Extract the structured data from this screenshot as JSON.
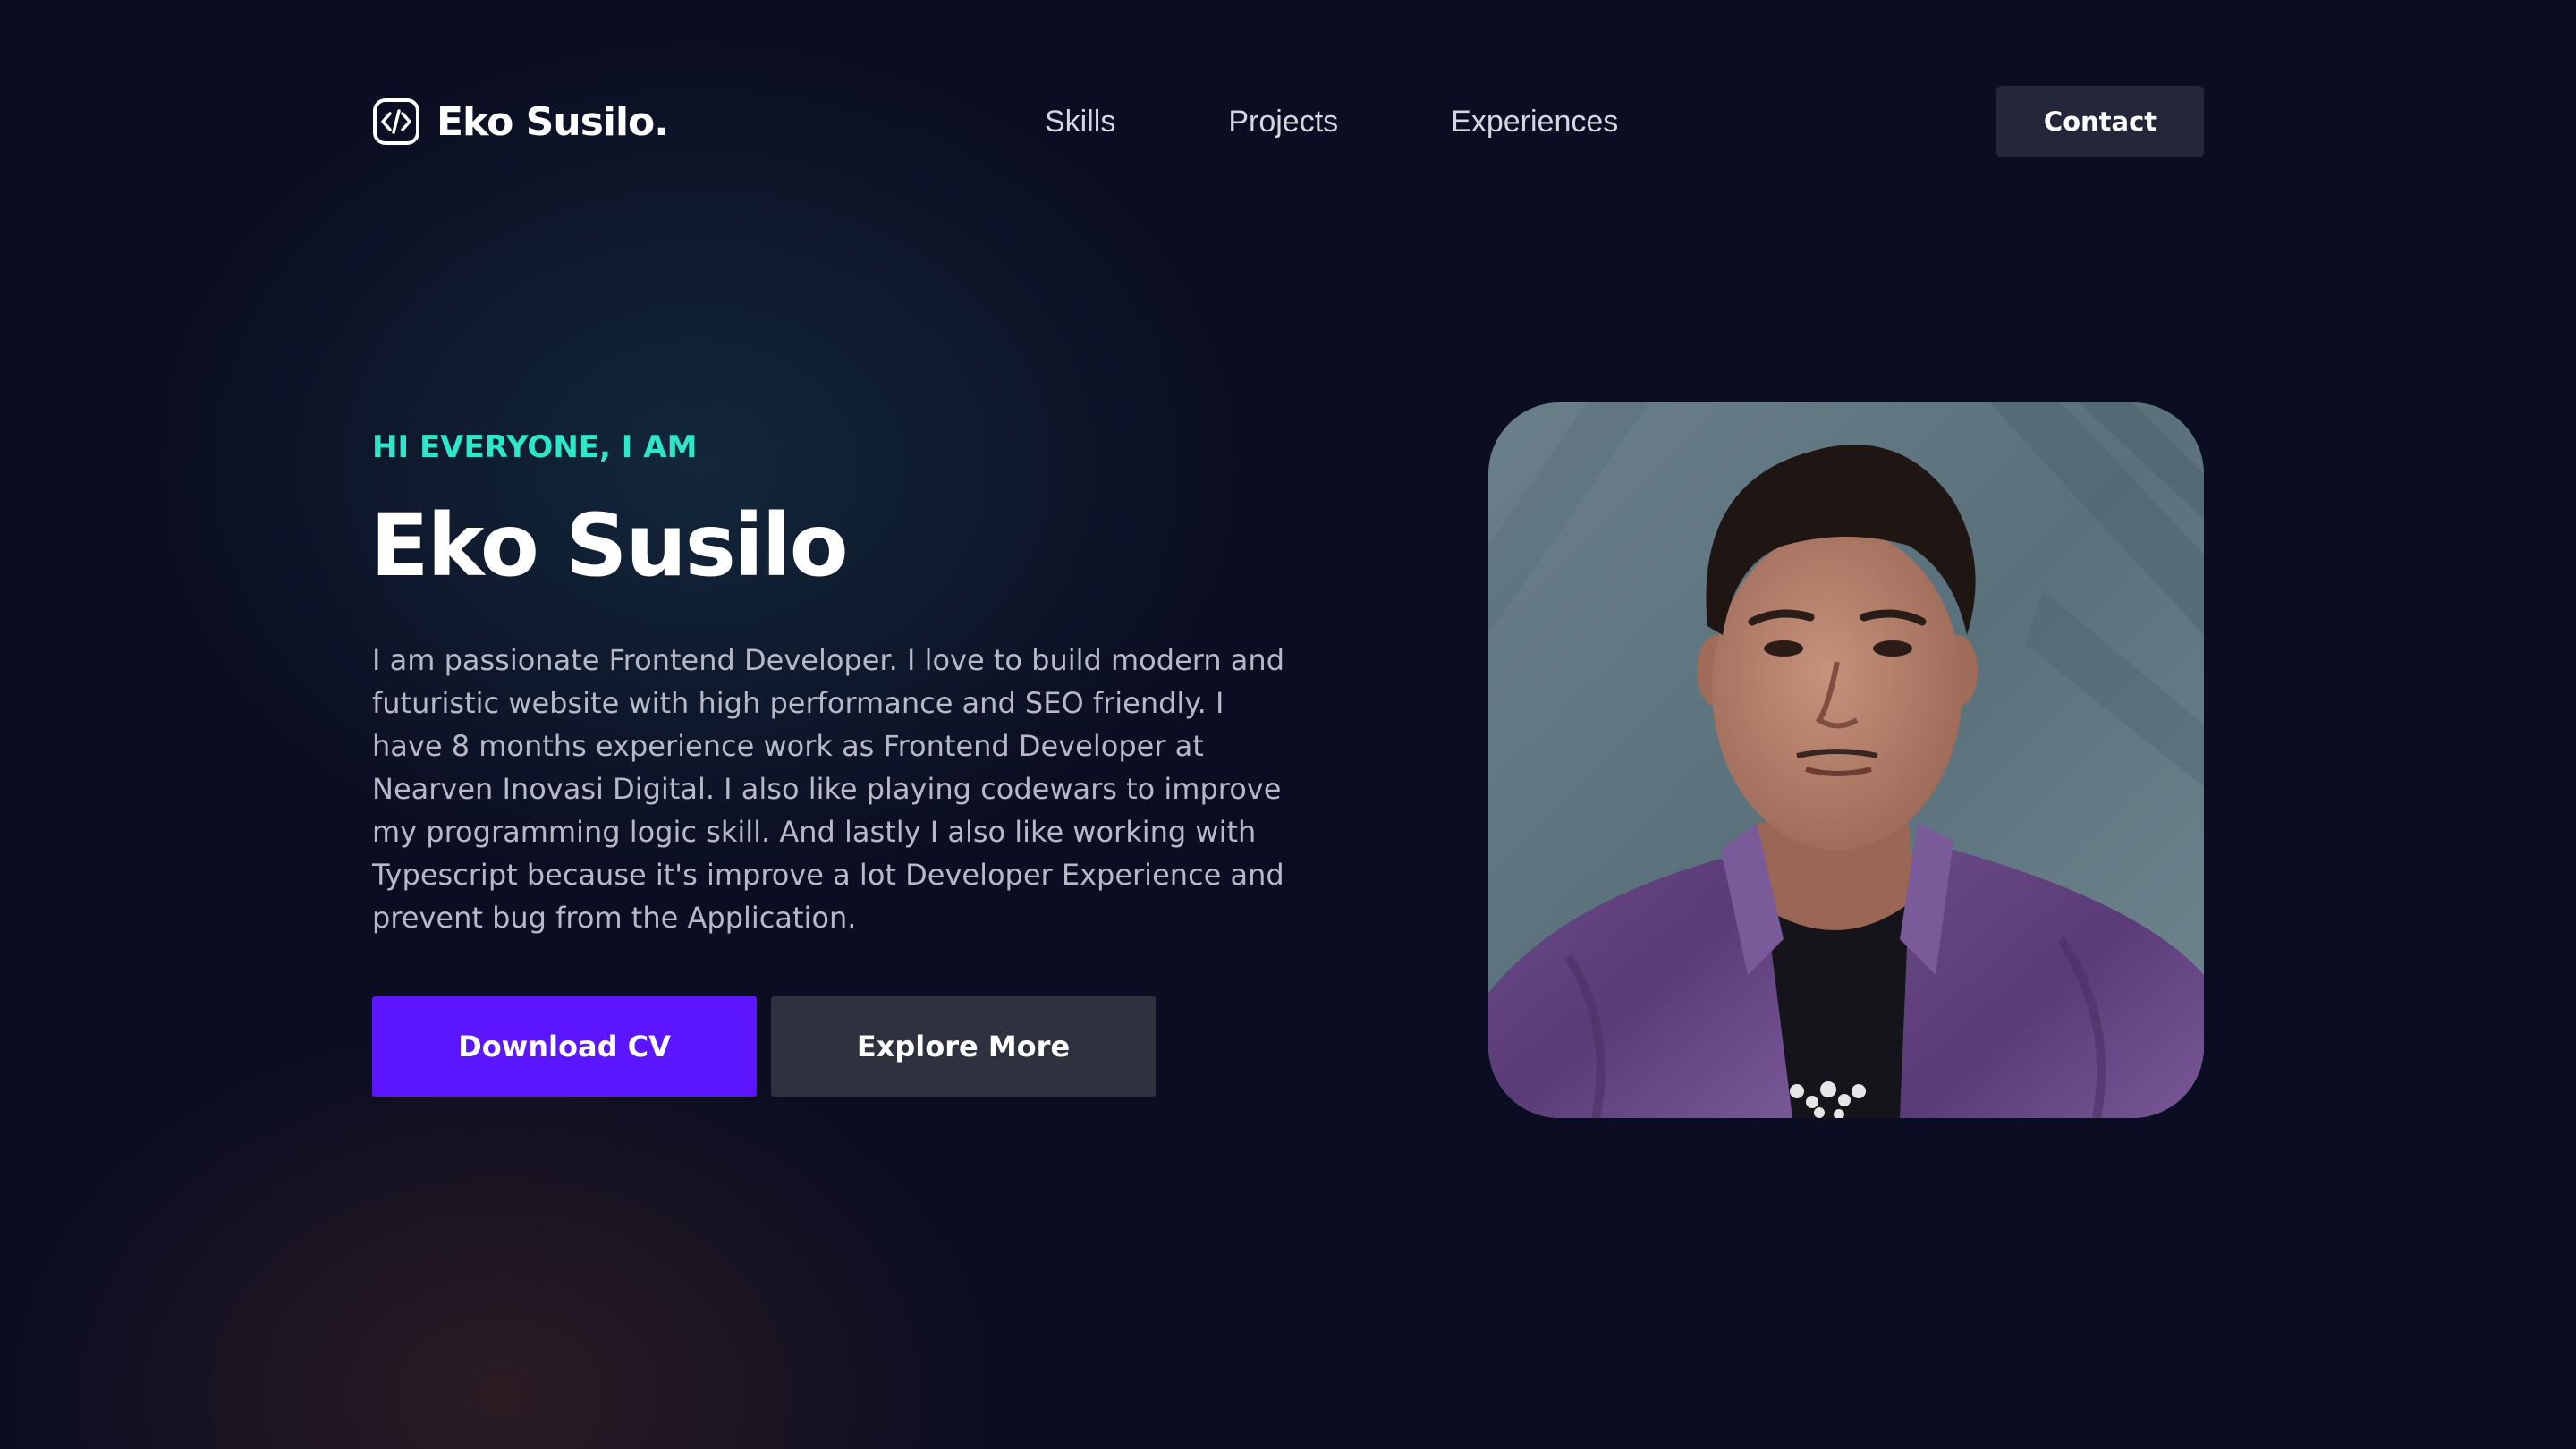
{
  "nav": {
    "logo_text": "Eko Susilo.",
    "logo_icon": "code-icon",
    "links": [
      "Skills",
      "Projects",
      "Experiences"
    ],
    "contact_label": "Contact"
  },
  "hero": {
    "greeting": "HI EVERYONE, I AM",
    "name": "Eko Susilo",
    "bio": "I am passionate Frontend Developer. I love to build modern and futuristic website with high performance and SEO friendly. I have 8 months experience work as Frontend Developer at Nearven Inovasi Digital. I also like playing codewars to improve my programming logic skill. And lastly I also like working with Typescript because it's improve a lot Developer Experience and prevent bug from the Application.",
    "primary_button": "Download CV",
    "secondary_button": "Explore More"
  },
  "colors": {
    "background": "#0b0d22",
    "accent_teal": "#2ee6c8",
    "primary_button": "#5b16ff",
    "secondary_button": "#2e323e",
    "contact_button": "#24273a"
  }
}
